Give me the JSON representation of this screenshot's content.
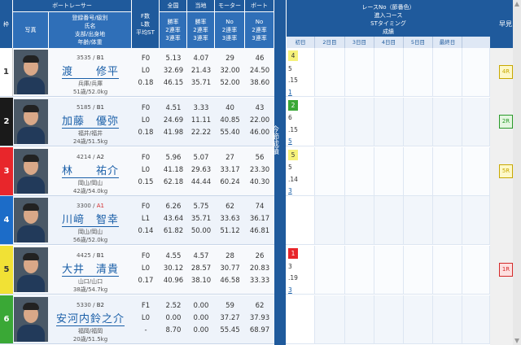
{
  "headers": {
    "waku": "枠",
    "photo": "写真",
    "boat_racer": "ボートレーサー",
    "racer_info": [
      "登録番号/級別",
      "氏名",
      "支部/出身地",
      "年齢/体重"
    ],
    "fls": [
      "F数",
      "L数",
      "平均ST"
    ],
    "zenkoku": "全国",
    "tochi": "当地",
    "motor": "モーター",
    "boat": "ボート",
    "rate_cols": [
      "勝率",
      "2連率",
      "3連率"
    ],
    "no_cols": [
      "No",
      "2連率",
      "3連率"
    ],
    "race_no": [
      "レースNo（節番色）",
      "進入コース",
      "STタイミング",
      "成績"
    ],
    "konsetsu": "今節成績",
    "yoso": "早見",
    "days": [
      "初日",
      "2日目",
      "3日目",
      "4日目",
      "5日目",
      "最終日"
    ]
  },
  "racers": [
    {
      "waku": "1",
      "reg": "3535",
      "cls": "B1",
      "name": "渡　　修平",
      "branch": "兵庫/兵庫",
      "age": "51歳/52.0kg",
      "f": "F0",
      "l": "L0",
      "st": "0.18",
      "zen": [
        "5.13",
        "32.69",
        "46.15"
      ],
      "toc": [
        "4.07",
        "21.43",
        "35.71"
      ],
      "mot": [
        "29",
        "32.00",
        "52.00"
      ],
      "bot": [
        "46",
        "24.50",
        "38.60"
      ],
      "res": [
        "4",
        "5",
        ".15",
        "1"
      ],
      "res_colors": [
        "#f6f27a",
        "",
        "",
        ""
      ],
      "yoso": "4R",
      "yoso_color": "#c8a800",
      "yoso_bg": "#fdf8c8"
    },
    {
      "waku": "2",
      "reg": "5185",
      "cls": "B1",
      "name": "加藤　優弥",
      "branch": "福井/福井",
      "age": "24歳/51.5kg",
      "f": "F0",
      "l": "L0",
      "st": "0.18",
      "zen": [
        "4.51",
        "24.69",
        "41.98"
      ],
      "toc": [
        "3.33",
        "11.11",
        "22.22"
      ],
      "mot": [
        "40",
        "40.85",
        "55.40"
      ],
      "bot": [
        "43",
        "22.00",
        "46.00"
      ],
      "res": [
        "2",
        "6",
        ".15",
        "5"
      ],
      "res_colors": [
        "#3aa836",
        "",
        "",
        ""
      ],
      "yoso": "2R",
      "yoso_color": "#2a9a2a",
      "yoso_bg": "#e4f6e0"
    },
    {
      "waku": "3",
      "reg": "4214",
      "cls": "A2",
      "name": "林　　祐介",
      "branch": "岡山/岡山",
      "age": "42歳/54.0kg",
      "f": "F0",
      "l": "L0",
      "st": "0.15",
      "zen": [
        "5.96",
        "41.18",
        "62.18"
      ],
      "toc": [
        "5.07",
        "29.63",
        "44.44"
      ],
      "mot": [
        "27",
        "33.17",
        "60.24"
      ],
      "bot": [
        "56",
        "23.30",
        "40.30"
      ],
      "res": [
        "5",
        "5",
        ".14",
        "3"
      ],
      "res_colors": [
        "#f6f27a",
        "",
        "",
        ""
      ],
      "yoso": "5R",
      "yoso_color": "#c8a800",
      "yoso_bg": "#fdf8c8"
    },
    {
      "waku": "4",
      "reg": "3300",
      "cls": "A1",
      "name": "川﨑　智幸",
      "branch": "岡山/岡山",
      "age": "56歳/52.0kg",
      "f": "F0",
      "l": "L1",
      "st": "0.14",
      "zen": [
        "6.26",
        "43.64",
        "61.82"
      ],
      "toc": [
        "5.75",
        "35.71",
        "50.00"
      ],
      "mot": [
        "62",
        "33.63",
        "51.12"
      ],
      "bot": [
        "74",
        "36.17",
        "46.81"
      ],
      "res": [],
      "res_colors": [],
      "yoso": "",
      "yoso_color": "",
      "yoso_bg": ""
    },
    {
      "waku": "5",
      "reg": "4425",
      "cls": "B1",
      "name": "大井　清貴",
      "branch": "山口/山口",
      "age": "38歳/54.7kg",
      "f": "F0",
      "l": "L0",
      "st": "0.17",
      "zen": [
        "4.55",
        "30.12",
        "40.96"
      ],
      "toc": [
        "4.57",
        "28.57",
        "38.10"
      ],
      "mot": [
        "28",
        "30.77",
        "46.58"
      ],
      "bot": [
        "26",
        "20.83",
        "33.33"
      ],
      "res": [
        "1",
        "3",
        ".19",
        "3"
      ],
      "res_colors": [
        "#e8262b",
        "",
        "",
        ""
      ],
      "yoso": "1R",
      "yoso_color": "#d42a2a",
      "yoso_bg": "#fde0e0"
    },
    {
      "waku": "6",
      "reg": "5330",
      "cls": "B2",
      "name": "安河内鈴之介",
      "branch": "福岡/福岡",
      "age": "20歳/51.5kg",
      "f": "F1",
      "l": "L0",
      "st": "-",
      "zen": [
        "2.52",
        "0.00",
        "8.70"
      ],
      "toc": [
        "0.00",
        "0.00",
        "0.00"
      ],
      "mot": [
        "59",
        "37.27",
        "55.45"
      ],
      "bot": [
        "62",
        "37.93",
        "68.97"
      ],
      "res": [],
      "res_colors": [],
      "yoso": "",
      "yoso_color": "",
      "yoso_bg": ""
    }
  ],
  "waku_colors": {
    "bg": [
      "#ffffff",
      "#1a1a1a",
      "#e8262b",
      "#1c6cc8",
      "#f1e135",
      "#3aa836"
    ],
    "fg": [
      "#333333",
      "#ffffff",
      "#ffffff",
      "#ffffff",
      "#333333",
      "#ffffff"
    ]
  },
  "class_colors": {
    "A1": "#d42a2a",
    "A2": "#333333",
    "B1": "#333333",
    "B2": "#333333"
  }
}
